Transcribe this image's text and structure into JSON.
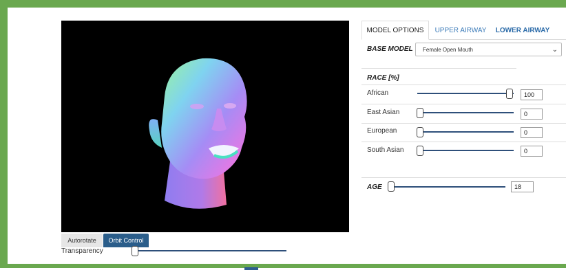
{
  "viewer": {
    "autorotate_label": "Autorotate",
    "orbit_label": "Orbit Control",
    "transparency_label": "Transparency",
    "transparency_value": 0
  },
  "tabs": {
    "model_options": "MODEL OPTIONS",
    "upper_airway": "UPPER AIRWAY",
    "lower_airway": "LOWER AIRWAY"
  },
  "base_model": {
    "label": "BASE MODEL",
    "selected": "Female Open Mouth"
  },
  "race": {
    "label": "RACE [%]",
    "items": [
      {
        "label": "African",
        "value": "100"
      },
      {
        "label": "East Asian",
        "value": "0"
      },
      {
        "label": "European",
        "value": "0"
      },
      {
        "label": "South Asian",
        "value": "0"
      }
    ]
  },
  "age": {
    "label": "AGE",
    "value": "18"
  }
}
